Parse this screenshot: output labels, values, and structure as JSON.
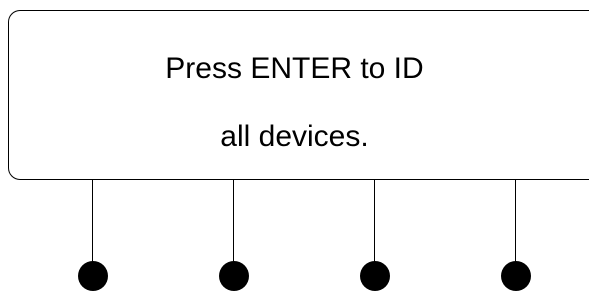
{
  "display": {
    "line1": "Press ENTER to ID",
    "line2": "all devices."
  },
  "softkeys": [
    {
      "id": "softkey-1"
    },
    {
      "id": "softkey-2"
    },
    {
      "id": "softkey-3"
    },
    {
      "id": "softkey-4"
    }
  ],
  "colors": {
    "background": "#ffffff",
    "foreground": "#000000"
  }
}
